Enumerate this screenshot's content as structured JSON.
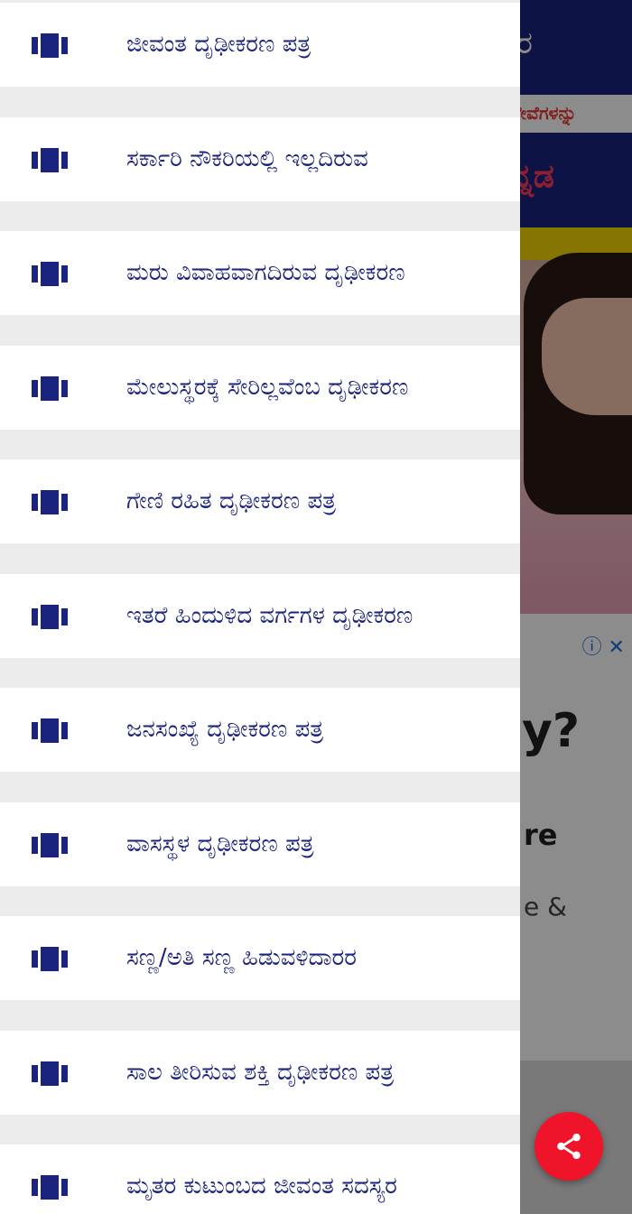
{
  "background_app": {
    "header_title_fragment": "ರ",
    "marquee_fragment": "ಸೇವೆಗಳನ್ನು",
    "banner_fragment": "ನ್ನಡ",
    "ad": {
      "line1_fragment": "y?",
      "line2_fragment": "re",
      "line3_fragment": "e &"
    }
  },
  "drawer": {
    "items": [
      {
        "label": "ಜೀವಂತ ದೃಢೀಕರಣ ಪತ್ರ",
        "icon": "view-carousel-icon"
      },
      {
        "label": "ಸರ್ಕಾರಿ ನೌಕರಿಯಲ್ಲಿ ಇಲ್ಲದಿರುವ",
        "icon": "view-carousel-icon"
      },
      {
        "label": "ಮರು ವಿವಾಹವಾಗದಿರುವ ದೃಢೀಕರಣ",
        "icon": "view-carousel-icon"
      },
      {
        "label": "ಮೇಲುಸ್ಥರಕ್ಕೆ ಸೇರಿಲ್ಲವೆಂಬ ದೃಢೀಕರಣ",
        "icon": "view-carousel-icon"
      },
      {
        "label": "ಗೇಣಿ ರಹಿತ ದೃಢೀಕರಣ ಪತ್ರ",
        "icon": "view-carousel-icon"
      },
      {
        "label": "ಇತರೆ ಹಿಂದುಳಿದ ವರ್ಗಗಳ ದೃಢೀಕರಣ",
        "icon": "view-carousel-icon"
      },
      {
        "label": "ಜನಸಂಖ್ಯೆ ದೃಢೀಕರಣ ಪತ್ರ",
        "icon": "view-carousel-icon"
      },
      {
        "label": "ವಾಸಸ್ಥಳ ದೃಢೀಕರಣ ಪತ್ರ",
        "icon": "view-carousel-icon"
      },
      {
        "label": "ಸಣ್ಣ/ಅತಿ ಸಣ್ಣ ಹಿಡುವಳಿದಾರರ",
        "icon": "view-carousel-icon"
      },
      {
        "label": "ಸಾಲ ತೀರಿಸುವ ಶಕ್ತಿ ದೃಢೀಕರಣ ಪತ್ರ",
        "icon": "view-carousel-icon"
      },
      {
        "label": "ಮೃತರ ಕುಟುಂಬದ ಜೀವಂತ ಸದಸ್ಯರ",
        "icon": "view-carousel-icon"
      }
    ]
  },
  "fab": {
    "icon": "share-icon"
  },
  "colors": {
    "drawer_text": "#1a237e",
    "icon": "#1a237e",
    "fab": "#f0142a",
    "header": "#1a237e"
  }
}
